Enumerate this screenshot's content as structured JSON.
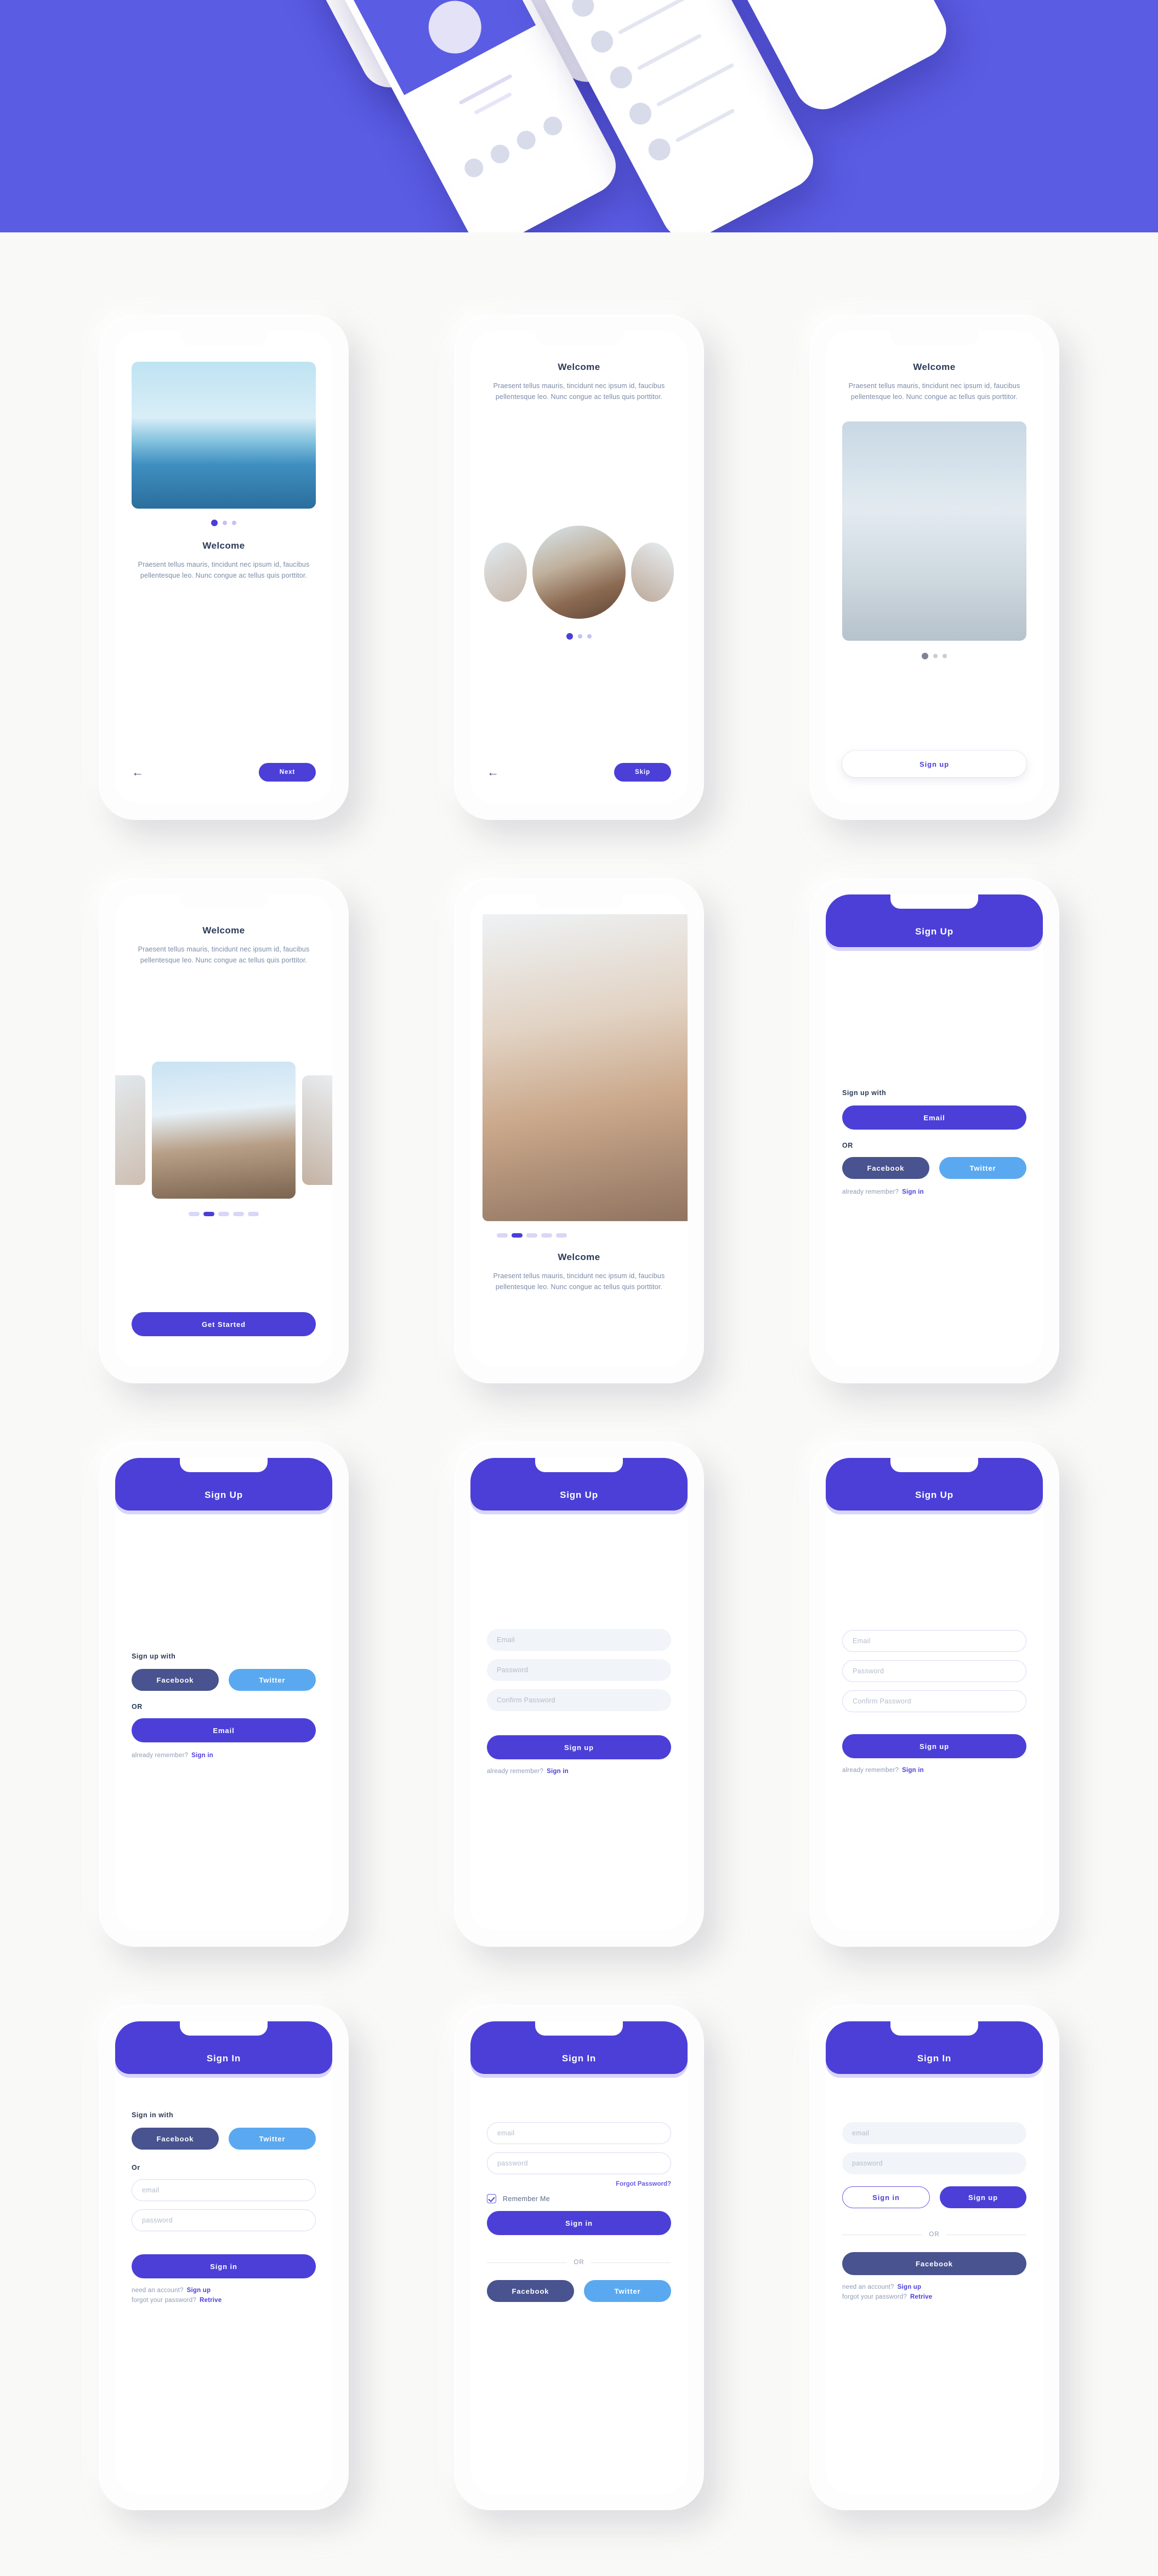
{
  "hero": {
    "background_color": "#5A5CE3"
  },
  "theme": {
    "primary": "#4B3FD8",
    "hero_purple": "#5A5CE3",
    "facebook": "#48538F",
    "twitter": "#5AA9F0",
    "page_background": "#F9F9F7",
    "heading_color": "#2B3A57",
    "body_text_color": "#7B8AA8"
  },
  "common": {
    "welcome_title": "Welcome",
    "welcome_body": "Praesent tellus mauris, tincidunt nec ipsum id, faucibus pellentesque leo. Nunc congue ac tellus quis porttitor.",
    "back_arrow": "←"
  },
  "screens": [
    {
      "id": "onboarding-image-next",
      "title": "Welcome",
      "body": "Praesent tellus mauris, tincidunt nec ipsum id, faucibus pellentesque leo. Nunc congue ac tellus quis porttitor.",
      "dots": {
        "count": 3,
        "active": 0,
        "style": "dots"
      },
      "back_label": "←",
      "primary_button": "Next"
    },
    {
      "id": "onboarding-circle-carousel-skip",
      "title": "Welcome",
      "body": "Praesent tellus mauris, tincidunt nec ipsum id, faucibus pellentesque leo. Nunc congue ac tellus quis porttitor.",
      "dots": {
        "count": 3,
        "active": 0,
        "style": "dots"
      },
      "back_label": "←",
      "primary_button": "Skip"
    },
    {
      "id": "onboarding-signup",
      "title": "Welcome",
      "body": "Praesent tellus mauris, tincidunt nec ipsum id, faucibus pellentesque leo. Nunc congue ac tellus quis porttitor.",
      "dots": {
        "count": 3,
        "active": 0,
        "style": "dots-gray"
      },
      "primary_button": "Sign up"
    },
    {
      "id": "onboarding-card-carousel",
      "title": "Welcome",
      "body": "Praesent tellus mauris, tincidunt nec ipsum id, faucibus pellentesque leo. Nunc congue ac tellus quis porttitor.",
      "dots": {
        "count": 5,
        "active": 1,
        "style": "bars"
      },
      "primary_button": "Get Started"
    },
    {
      "id": "onboarding-photo-bottom-text",
      "title": "Welcome",
      "body": "Praesent tellus mauris, tincidunt nec ipsum id, faucibus pellentesque leo. Nunc congue ac tellus quis porttitor.",
      "dots": {
        "count": 5,
        "active": 1,
        "style": "bars"
      }
    },
    {
      "id": "signup-email-first",
      "appbar_title": "Sign Up",
      "section_label": "Sign up with",
      "email_button": "Email",
      "or_label": "OR",
      "facebook_button": "Facebook",
      "twitter_button": "Twitter",
      "footer_text": "already remember?",
      "footer_link": "Sign in"
    },
    {
      "id": "signup-social-first",
      "appbar_title": "Sign Up",
      "section_label": "Sign up with",
      "facebook_button": "Facebook",
      "twitter_button": "Twitter",
      "or_label": "OR",
      "email_button": "Email",
      "footer_text": "already remember?",
      "footer_link": "Sign in"
    },
    {
      "id": "signup-form-filled",
      "appbar_title": "Sign Up",
      "fields": [
        {
          "name": "email",
          "placeholder": "Email"
        },
        {
          "name": "password",
          "placeholder": "Password"
        },
        {
          "name": "confirm-password",
          "placeholder": "Confirm Password"
        }
      ],
      "primary_button": "Sign up",
      "footer_text": "already remember?",
      "footer_link": "Sign in"
    },
    {
      "id": "signup-form-outlined",
      "appbar_title": "Sign Up",
      "fields": [
        {
          "name": "email",
          "placeholder": "Email"
        },
        {
          "name": "password",
          "placeholder": "Password"
        },
        {
          "name": "confirm-password",
          "placeholder": "Confirm Password"
        }
      ],
      "primary_button": "Sign up",
      "footer_text": "already remember?",
      "footer_link": "Sign in"
    },
    {
      "id": "signin-social-top",
      "appbar_title": "Sign In",
      "section_label": "Sign in with",
      "facebook_button": "Facebook",
      "twitter_button": "Twitter",
      "or_label": "Or",
      "fields": [
        {
          "name": "email",
          "placeholder": "email"
        },
        {
          "name": "password",
          "placeholder": "password"
        }
      ],
      "primary_button": "Sign in",
      "footer_lines": [
        {
          "text": "need an account?",
          "link": "Sign up"
        },
        {
          "text": "forgot your password?",
          "link": "Retrive"
        }
      ]
    },
    {
      "id": "signin-remember-me",
      "appbar_title": "Sign In",
      "fields": [
        {
          "name": "email",
          "placeholder": "email"
        },
        {
          "name": "password",
          "placeholder": "password"
        }
      ],
      "forgot_link": "Forgot Password?",
      "remember_label": "Remember Me",
      "remember_checked": true,
      "primary_button": "Sign in",
      "or_label": "OR",
      "facebook_button": "Facebook",
      "twitter_button": "Twitter"
    },
    {
      "id": "signin-dual-action",
      "appbar_title": "Sign In",
      "fields": [
        {
          "name": "email",
          "placeholder": "email"
        },
        {
          "name": "password",
          "placeholder": "password"
        }
      ],
      "signin_button": "Sign in",
      "signup_button": "Sign up",
      "or_label": "OR",
      "facebook_button": "Facebook",
      "footer_lines": [
        {
          "text": "need an account?",
          "link": "Sign up"
        },
        {
          "text": "forgot your password?",
          "link": "Retrive"
        }
      ]
    }
  ]
}
